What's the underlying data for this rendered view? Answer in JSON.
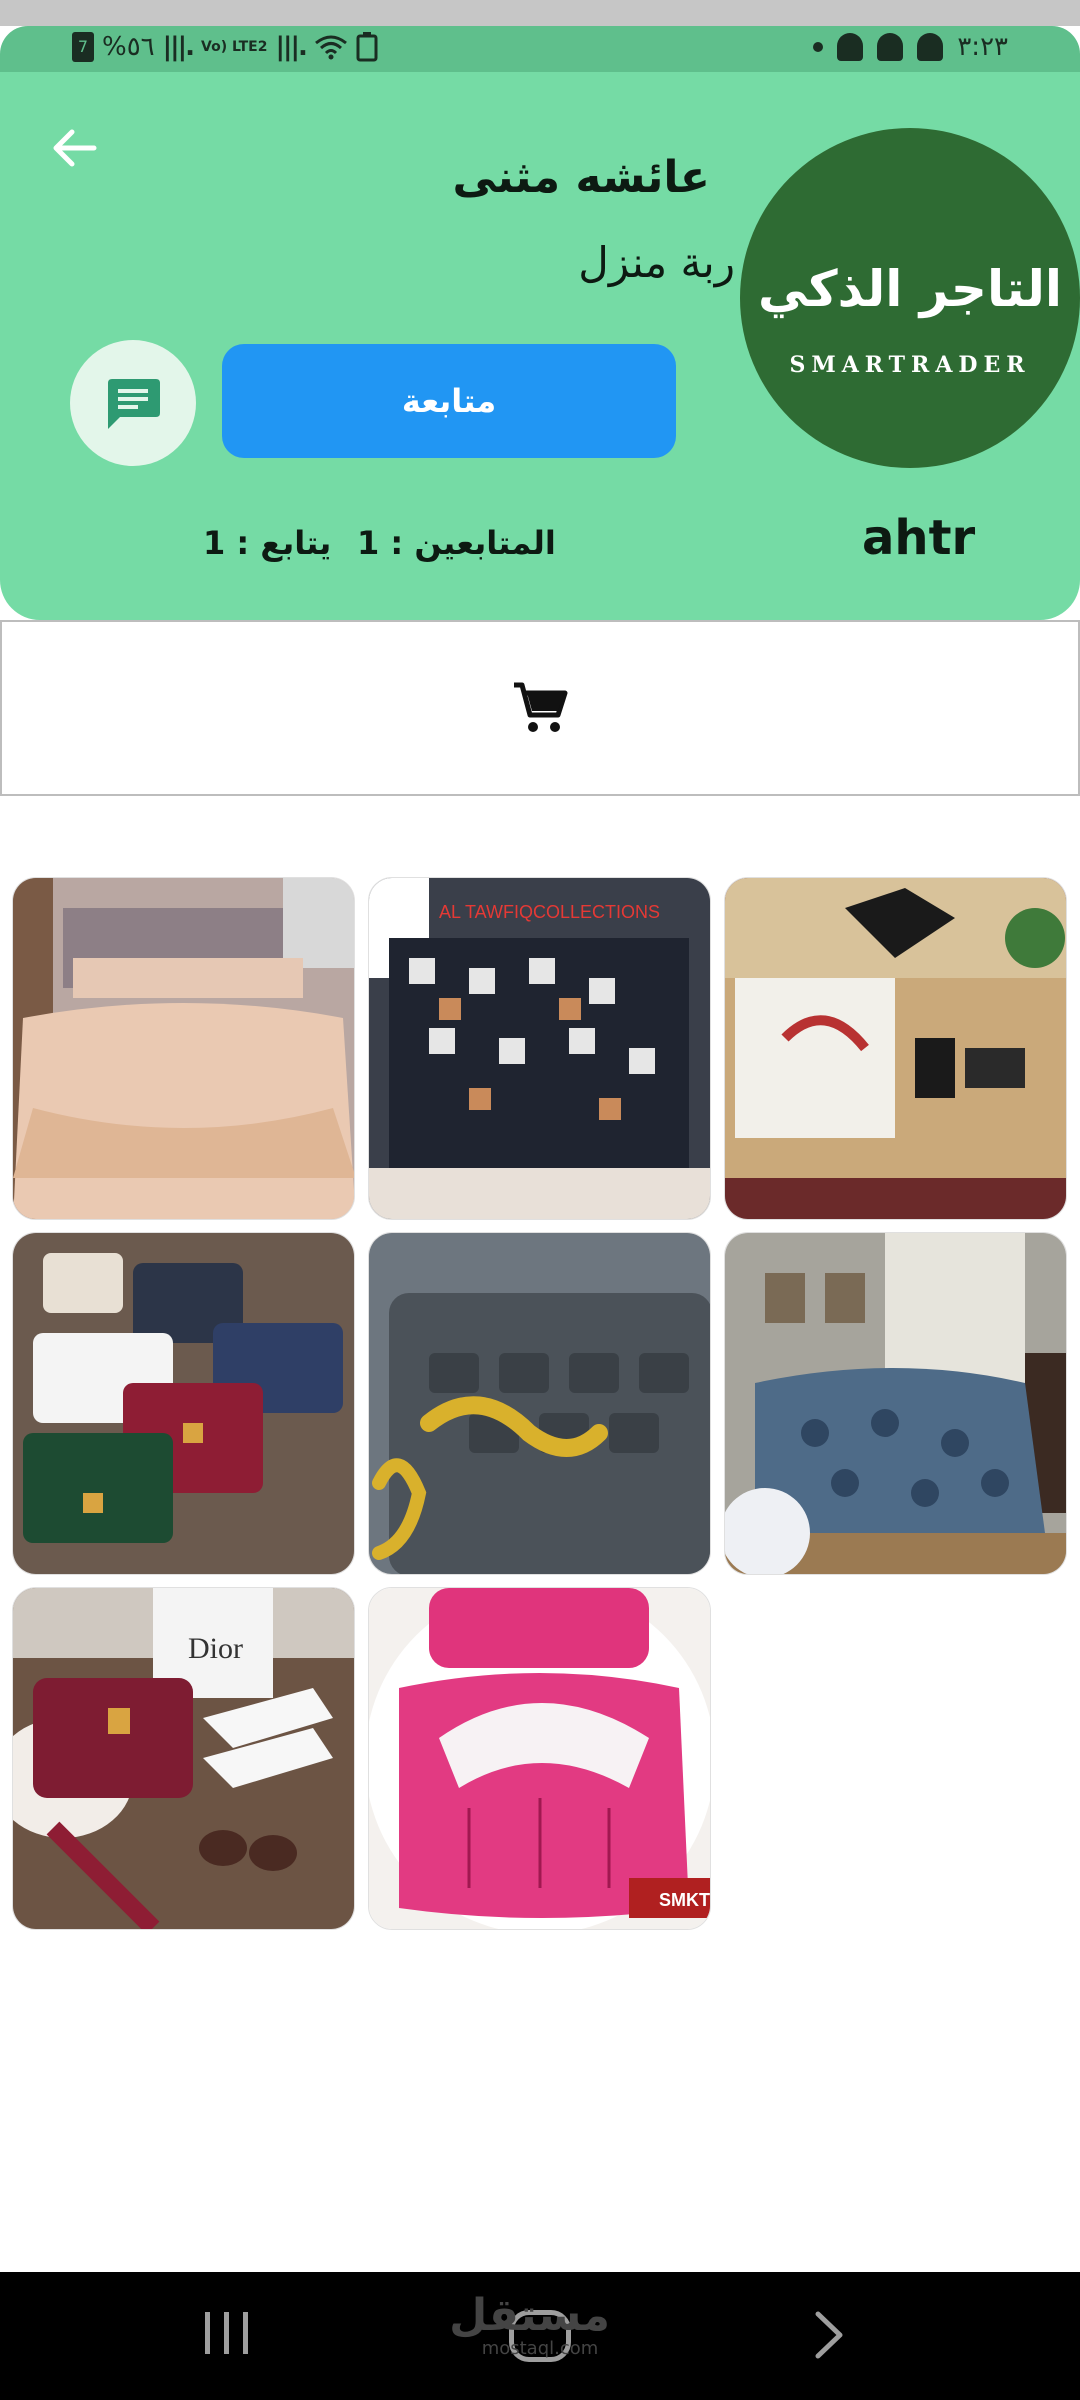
{
  "status_bar": {
    "battery_level_icon_text": "7",
    "battery_percent": "%٥٦",
    "network_label": "Vo) LTE2",
    "time": "٣:٢٣"
  },
  "header": {
    "store_name": "عائشه مثنى",
    "store_description": "ربة منزل",
    "follow_button_label": "متابعة",
    "followers_label": "المتابعين : 1",
    "following_label": "يتابع : 1",
    "username": "ahtr",
    "logo": {
      "arabic_text": "التاجر الذكي",
      "english_text": "SMARTRADER"
    }
  },
  "tabs": {
    "active_icon": "shopping-cart-icon"
  },
  "products": [
    {
      "name": "product-bedding-beige",
      "overlay": ""
    },
    {
      "name": "product-bedding-checkered",
      "overlay": "AL TAWFIQCOLLECTIONS"
    },
    {
      "name": "product-gift-box",
      "overlay": ""
    },
    {
      "name": "product-handbags",
      "overlay": ""
    },
    {
      "name": "product-gold-name-pendant",
      "overlay": ""
    },
    {
      "name": "product-bedding-blue",
      "overlay": ""
    },
    {
      "name": "product-handbag-shoes",
      "overlay": "Dior"
    },
    {
      "name": "product-bedding-pink",
      "overlay": "SMKT"
    }
  ],
  "watermark": {
    "arabic": "مستقل",
    "latin": "mostaql.com"
  },
  "colors": {
    "header_green": "#75dba5",
    "status_green": "#5fbf8c",
    "logo_green": "#2e6b33",
    "follow_blue": "#2196f3"
  }
}
